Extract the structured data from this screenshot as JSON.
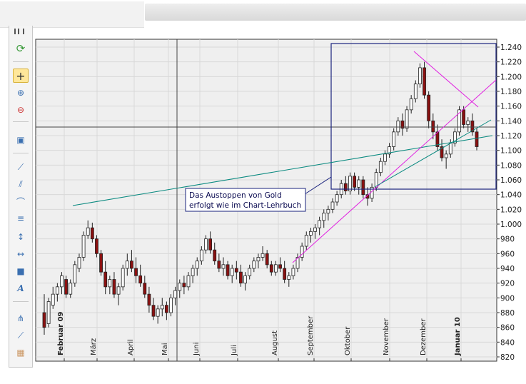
{
  "chart_data": {
    "type": "candlestick",
    "title": "",
    "xlabel": "",
    "ylabel": "",
    "ylim": [
      820,
      1240
    ],
    "y_ticks": [
      "1.240",
      "1.220",
      "1.200",
      "1.180",
      "1.160",
      "1.140",
      "1.120",
      "1.100",
      "1.080",
      "1.060",
      "1.040",
      "1.020",
      "1.000",
      "980",
      "960",
      "940",
      "920",
      "900",
      "880",
      "860",
      "840",
      "820"
    ],
    "x_ticks": [
      "Februar 09",
      "März",
      "April",
      "Mai",
      "Juni",
      "Juli",
      "August",
      "September",
      "Oktober",
      "November",
      "Dezember",
      "Januar 10"
    ],
    "x_ticks_bold": [
      "Februar 09",
      "Januar 10"
    ],
    "grid": true,
    "annotation": [
      "Das Austoppen von Gold",
      "erfolgt wie im Chart-Lehrbuch"
    ],
    "series": [
      {
        "values": [
          [
            880,
            905,
            850,
            860
          ],
          [
            865,
            900,
            860,
            895
          ],
          [
            890,
            915,
            885,
            905
          ],
          [
            905,
            920,
            895,
            915
          ],
          [
            915,
            935,
            905,
            930
          ],
          [
            925,
            930,
            900,
            905
          ],
          [
            905,
            925,
            900,
            920
          ],
          [
            920,
            950,
            915,
            945
          ],
          [
            940,
            960,
            935,
            955
          ],
          [
            955,
            990,
            950,
            985
          ],
          [
            985,
            1005,
            980,
            995
          ],
          [
            995,
            1002,
            975,
            980
          ],
          [
            980,
            985,
            955,
            960
          ],
          [
            960,
            965,
            930,
            935
          ],
          [
            935,
            950,
            905,
            915
          ],
          [
            915,
            930,
            905,
            925
          ],
          [
            925,
            935,
            900,
            905
          ],
          [
            905,
            920,
            890,
            915
          ],
          [
            915,
            945,
            910,
            940
          ],
          [
            940,
            960,
            930,
            950
          ],
          [
            950,
            965,
            935,
            940
          ],
          [
            940,
            955,
            920,
            930
          ],
          [
            930,
            945,
            915,
            920
          ],
          [
            920,
            930,
            900,
            905
          ],
          [
            905,
            915,
            880,
            890
          ],
          [
            890,
            900,
            870,
            875
          ],
          [
            875,
            890,
            865,
            885
          ],
          [
            885,
            900,
            875,
            890
          ],
          [
            890,
            895,
            870,
            880
          ],
          [
            880,
            905,
            875,
            900
          ],
          [
            900,
            915,
            890,
            910
          ],
          [
            910,
            925,
            900,
            920
          ],
          [
            920,
            930,
            905,
            915
          ],
          [
            915,
            935,
            910,
            930
          ],
          [
            930,
            945,
            920,
            940
          ],
          [
            940,
            955,
            930,
            950
          ],
          [
            950,
            970,
            945,
            965
          ],
          [
            965,
            985,
            960,
            980
          ],
          [
            980,
            990,
            960,
            965
          ],
          [
            965,
            975,
            945,
            950
          ],
          [
            950,
            960,
            935,
            940
          ],
          [
            940,
            955,
            930,
            945
          ],
          [
            945,
            950,
            925,
            930
          ],
          [
            930,
            945,
            920,
            940
          ],
          [
            940,
            950,
            925,
            935
          ],
          [
            935,
            945,
            915,
            920
          ],
          [
            920,
            935,
            910,
            930
          ],
          [
            930,
            945,
            925,
            940
          ],
          [
            940,
            955,
            935,
            950
          ],
          [
            950,
            960,
            940,
            955
          ],
          [
            955,
            970,
            950,
            960
          ],
          [
            960,
            965,
            940,
            945
          ],
          [
            945,
            950,
            930,
            935
          ],
          [
            935,
            950,
            930,
            945
          ],
          [
            945,
            955,
            935,
            940
          ],
          [
            940,
            950,
            920,
            925
          ],
          [
            925,
            935,
            915,
            930
          ],
          [
            930,
            945,
            925,
            940
          ],
          [
            940,
            960,
            935,
            955
          ],
          [
            955,
            975,
            950,
            970
          ],
          [
            970,
            990,
            965,
            985
          ],
          [
            985,
            995,
            975,
            990
          ],
          [
            990,
            1000,
            980,
            995
          ],
          [
            995,
            1010,
            985,
            1005
          ],
          [
            1005,
            1020,
            995,
            1015
          ],
          [
            1015,
            1025,
            1005,
            1020
          ],
          [
            1020,
            1035,
            1015,
            1030
          ],
          [
            1030,
            1045,
            1025,
            1040
          ],
          [
            1040,
            1060,
            1035,
            1055
          ],
          [
            1055,
            1065,
            1040,
            1045
          ],
          [
            1045,
            1070,
            1040,
            1065
          ],
          [
            1065,
            1070,
            1045,
            1050
          ],
          [
            1050,
            1065,
            1040,
            1060
          ],
          [
            1060,
            1065,
            1035,
            1040
          ],
          [
            1040,
            1050,
            1025,
            1035
          ],
          [
            1035,
            1055,
            1030,
            1050
          ],
          [
            1050,
            1075,
            1045,
            1070
          ],
          [
            1070,
            1090,
            1065,
            1085
          ],
          [
            1085,
            1100,
            1080,
            1095
          ],
          [
            1095,
            1110,
            1090,
            1105
          ],
          [
            1105,
            1130,
            1100,
            1125
          ],
          [
            1125,
            1145,
            1120,
            1140
          ],
          [
            1140,
            1150,
            1120,
            1130
          ],
          [
            1130,
            1160,
            1125,
            1155
          ],
          [
            1155,
            1175,
            1150,
            1170
          ],
          [
            1170,
            1195,
            1165,
            1190
          ],
          [
            1190,
            1218,
            1185,
            1212
          ],
          [
            1212,
            1220,
            1170,
            1175
          ],
          [
            1175,
            1180,
            1130,
            1140
          ],
          [
            1140,
            1150,
            1115,
            1125
          ],
          [
            1125,
            1135,
            1100,
            1105
          ],
          [
            1105,
            1115,
            1085,
            1090
          ],
          [
            1090,
            1100,
            1075,
            1095
          ],
          [
            1095,
            1115,
            1090,
            1110
          ],
          [
            1110,
            1130,
            1105,
            1125
          ],
          [
            1125,
            1160,
            1120,
            1155
          ],
          [
            1155,
            1160,
            1130,
            1135
          ],
          [
            1135,
            1145,
            1125,
            1140
          ],
          [
            1140,
            1150,
            1120,
            1125
          ],
          [
            1125,
            1130,
            1100,
            1105
          ]
        ]
      }
    ]
  }
}
